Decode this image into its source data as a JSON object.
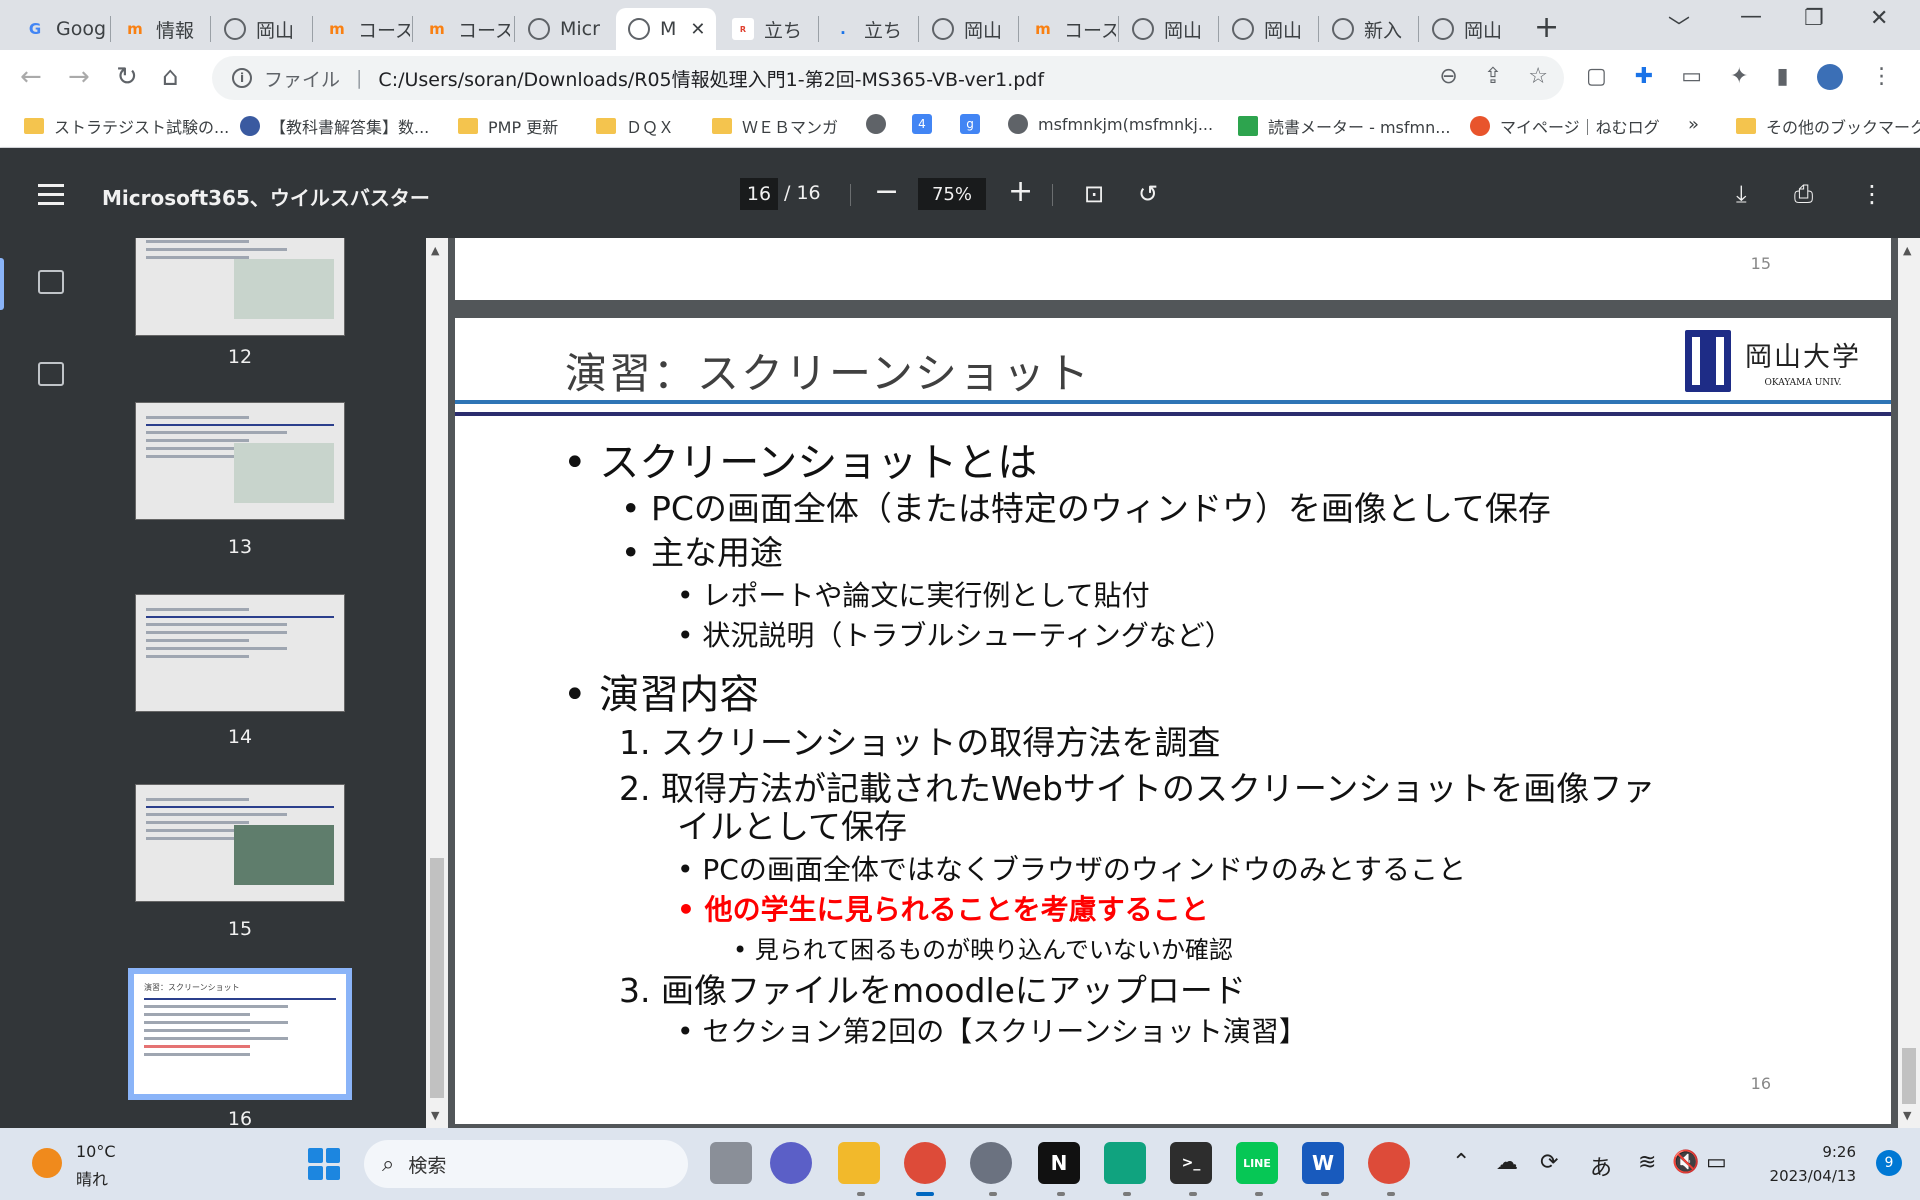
{
  "tabs": [
    {
      "title": "Goog",
      "icon": "google-icon"
    },
    {
      "title": "情報",
      "icon": "moodle-icon"
    },
    {
      "title": "岡山",
      "icon": "globe-icon"
    },
    {
      "title": "コース",
      "icon": "moodle-icon"
    },
    {
      "title": "コース",
      "icon": "moodle-icon"
    },
    {
      "title": "Micr",
      "icon": "globe-icon"
    },
    {
      "title": "M",
      "icon": "globe-icon",
      "active": true
    },
    {
      "title": "立ち",
      "icon": "ready-icon"
    },
    {
      "title": "立ち",
      "icon": "dot-icon"
    },
    {
      "title": "岡山",
      "icon": "globe-icon"
    },
    {
      "title": "コース",
      "icon": "moodle-icon"
    },
    {
      "title": "岡山",
      "icon": "globe-icon"
    },
    {
      "title": "岡山",
      "icon": "globe-icon"
    },
    {
      "title": "新入",
      "icon": "globe-icon"
    },
    {
      "title": "岡山",
      "icon": "globe-icon"
    }
  ],
  "tabstrip": {
    "new_tab": "+",
    "minimize": "﹀",
    "restore": "❐",
    "close": "✕",
    "tab_close": "✕",
    "favicon_text": {
      "google": "G",
      "moodle": "m",
      "ready": "R"
    }
  },
  "toolbar": {
    "file_label": "ファイル",
    "url": "C:/Users/soran/Downloads/R05情報処理入門1-第2回-MS365-VB-ver1.pdf",
    "info": "i"
  },
  "bookmarks": [
    {
      "label": "ストラテジスト試験の...",
      "icon": "folder"
    },
    {
      "label": "【教科書解答集】数...",
      "icon": "site"
    },
    {
      "label": "PMP 更新",
      "icon": "folder"
    },
    {
      "label": "ＤＱＸ",
      "icon": "folder"
    },
    {
      "label": "ＷＥＢマンガ",
      "icon": "folder"
    },
    {
      "label": "",
      "icon": "globe"
    },
    {
      "label": "",
      "icon": "four"
    },
    {
      "label": "",
      "icon": "g"
    },
    {
      "label": "msfmnkjm(msfmnkj...",
      "icon": "globe"
    },
    {
      "label": "読書メーター - msfmn...",
      "icon": "bars"
    },
    {
      "label": "マイページ｜ねむログ",
      "icon": "clock"
    },
    {
      "label": "»",
      "icon": "none"
    },
    {
      "label": "その他のブックマーク",
      "icon": "folder"
    }
  ],
  "bookmark_glyphs": {
    "four": "4",
    "g": "g"
  },
  "pdf": {
    "title": "Microsoft365、ウイルスバスター",
    "current_page": "16",
    "total_pages": "/ 16",
    "zoom": "75%",
    "zoom_out": "−",
    "zoom_in": "+"
  },
  "thumbnails": [
    {
      "page": "12"
    },
    {
      "page": "13"
    },
    {
      "page": "14"
    },
    {
      "page": "15"
    },
    {
      "page": "16",
      "current": true
    }
  ],
  "thumbnail_titles": [
    "演習：スクリーンショット"
  ],
  "prev_page_number": "15",
  "slide": {
    "title": "演習：スクリーンショット",
    "logo_jp": "岡山大学",
    "logo_en": "OKAYAMA UNIV.",
    "page_number": "16",
    "items": [
      {
        "text": "• スクリーンショットとは"
      },
      {
        "text": "• PCの画面全体（または特定のウィンドウ）を画像として保存"
      },
      {
        "text": "• 主な用途"
      },
      {
        "text": "• レポートや論文に実行例として貼付"
      },
      {
        "text": "• 状況説明（トラブルシューティングなど）"
      },
      {
        "text": "• 演習内容"
      },
      {
        "text": "1.  スクリーンショットの取得方法を調査"
      },
      {
        "text": "2.  取得方法が記載されたWebサイトのスクリーンショットを画像ファ"
      },
      {
        "text": "イルとして保存"
      },
      {
        "text": "• PCの画面全体ではなくブラウザのウィンドウのみとすること"
      },
      {
        "text": "• 他の学生に見られることを考慮すること"
      },
      {
        "text": "• 見られて困るものが映り込んでいないか確認"
      },
      {
        "text": "3.  画像ファイルをmoodleにアップロード"
      },
      {
        "text": "• セクション第2回の【スクリーンショット演習】"
      }
    ]
  },
  "taskbar": {
    "temperature": "10°C",
    "weather": "晴れ",
    "search_placeholder": "検索",
    "time": "9:26",
    "date": "2023/04/13",
    "notifications": "9",
    "ime": "あ",
    "apps": [
      "file-explorer",
      "chrome",
      "settings",
      "notion",
      "chatgpt",
      "terminal",
      "line",
      "word",
      "chrome-profile"
    ],
    "app_glyphs": {
      "notion": "N",
      "terminal": ">_",
      "line": "LINE",
      "word": "W"
    }
  },
  "colors": {
    "accent_blue": "#2e75b6",
    "navy": "#2b2d6e",
    "warning_red": "#ff0000",
    "pdf_bar": "#323639",
    "thumb_highlight": "#8ab4f8"
  }
}
